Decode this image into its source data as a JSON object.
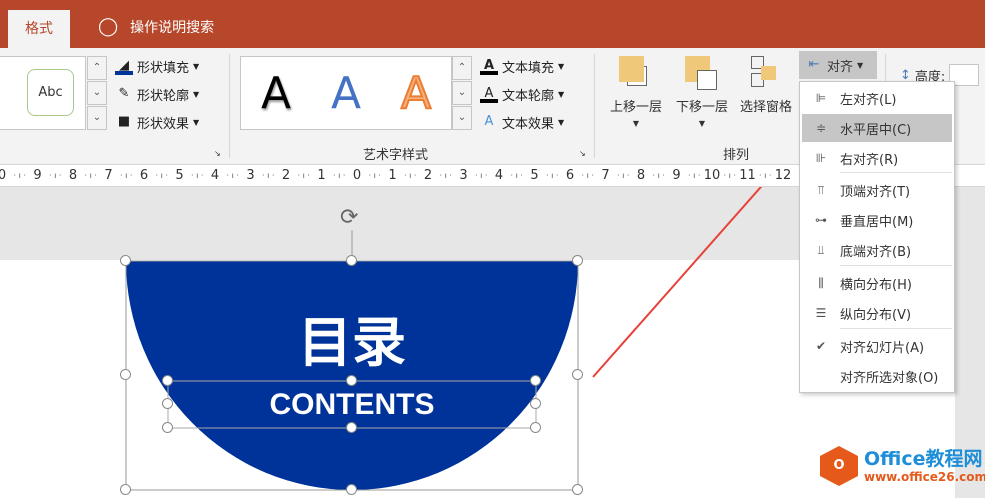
{
  "tabs": {
    "format": "格式",
    "search": "操作说明搜索"
  },
  "shape_styles": {
    "sample": "Abc",
    "fill": "形状填充",
    "outline": "形状轮廓",
    "effects": "形状效果"
  },
  "wordart": {
    "samples": [
      "A",
      "A",
      "A"
    ],
    "fill": "文本填充",
    "outline": "文本轮廓",
    "effects": "文本效果",
    "group": "艺术字样式"
  },
  "arrange": {
    "bring_forward": "上移一层",
    "send_backward": "下移一层",
    "selection_pane": "选择窗格",
    "align": "对齐",
    "group": "排列"
  },
  "size": {
    "height_label": "高度:"
  },
  "ruler": [
    "0",
    "9",
    "8",
    "7",
    "6",
    "5",
    "4",
    "3",
    "2",
    "1",
    "0",
    "1",
    "2",
    "3",
    "4",
    "5",
    "6",
    "7",
    "8",
    "9",
    "10",
    "11",
    "12"
  ],
  "menu": [
    {
      "icon": "align-left-icon",
      "label": "左对齐(L)"
    },
    {
      "icon": "align-center-icon",
      "label": "水平居中(C)",
      "selected": true
    },
    {
      "icon": "align-right-icon",
      "label": "右对齐(R)"
    },
    {
      "icon": "align-top-icon",
      "label": "顶端对齐(T)"
    },
    {
      "icon": "align-middle-icon",
      "label": "垂直居中(M)"
    },
    {
      "icon": "align-bottom-icon",
      "label": "底端对齐(B)"
    },
    {
      "icon": "distribute-h-icon",
      "label": "横向分布(H)"
    },
    {
      "icon": "distribute-v-icon",
      "label": "纵向分布(V)"
    },
    {
      "icon": "check-icon",
      "label": "对齐幻灯片(A)",
      "checked": true
    },
    {
      "icon": "",
      "label": "对齐所选对象(O)"
    }
  ],
  "slide": {
    "title": "目录",
    "subtitle": "CONTENTS",
    "shape_color": "#003399"
  },
  "watermark": {
    "brand": "Office教程网",
    "url": "www.office26.com"
  },
  "colors": {
    "accent": "#b7472a",
    "arrow": "#e8413a"
  }
}
